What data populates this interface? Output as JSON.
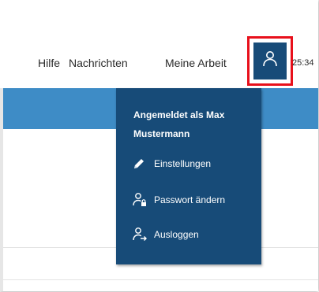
{
  "nav": {
    "items": [
      {
        "label": "Hilfe"
      },
      {
        "label": "Nachrichten"
      },
      {
        "label": "Meine Arbeit"
      }
    ],
    "clock": "25:34",
    "user_icon": "user-icon"
  },
  "dropdown": {
    "title": "Angemeldet als Max Mustermann",
    "items": [
      {
        "label": "Einstellungen",
        "icon": "pencil-icon"
      },
      {
        "label": "Passwort ändern",
        "icon": "user-lock-icon"
      },
      {
        "label": "Ausloggen",
        "icon": "user-logout-icon"
      }
    ]
  },
  "colors": {
    "dropdown_bg": "#174b78",
    "band": "#3e8cc6",
    "highlight": "#e8101b"
  }
}
